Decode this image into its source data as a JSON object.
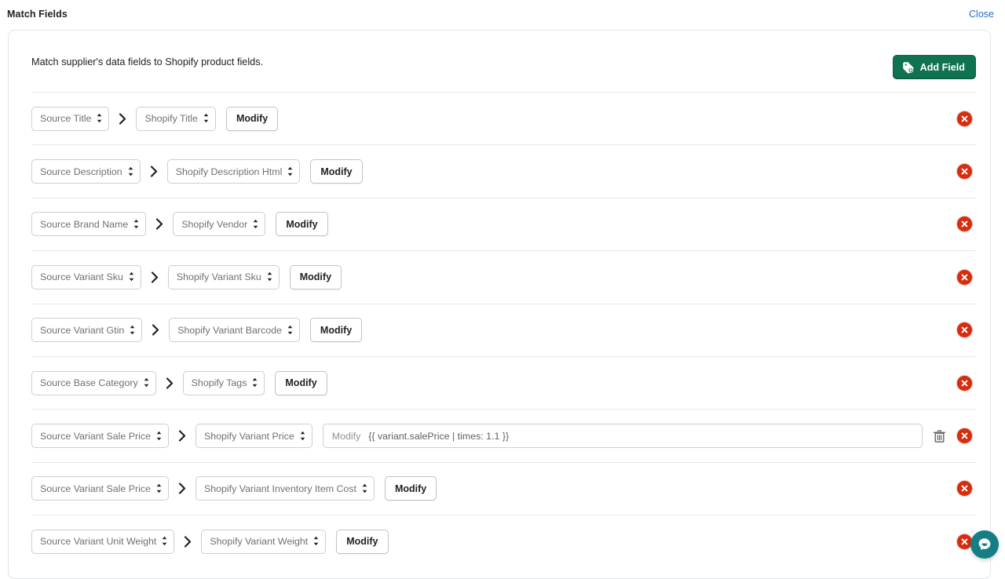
{
  "topbar": {
    "title": "Match Fields",
    "close_label": "Close"
  },
  "card": {
    "description": "Match supplier's data fields to Shopify product fields.",
    "add_field_label": "Add Field",
    "add_field_icon": "tag-plus-icon",
    "accent_green": "#0f7250",
    "accent_blue": "#2c6ecb",
    "accent_red": "#d82c0d",
    "chat_teal": "#157e84"
  },
  "rows": [
    {
      "source": "Source Title",
      "target": "Shopify Title",
      "modify_label": "Modify",
      "modify_expanded": false,
      "modify_value": "",
      "has_trash": false,
      "remove_label": "Remove field"
    },
    {
      "source": "Source Description",
      "target": "Shopify Description Html",
      "modify_label": "Modify",
      "modify_expanded": false,
      "modify_value": "",
      "has_trash": false,
      "remove_label": "Remove field"
    },
    {
      "source": "Source Brand Name",
      "target": "Shopify Vendor",
      "modify_label": "Modify",
      "modify_expanded": false,
      "modify_value": "",
      "has_trash": false,
      "remove_label": "Remove field"
    },
    {
      "source": "Source Variant Sku",
      "target": "Shopify Variant Sku",
      "modify_label": "Modify",
      "modify_expanded": false,
      "modify_value": "",
      "has_trash": false,
      "remove_label": "Remove field"
    },
    {
      "source": "Source Variant Gtin",
      "target": "Shopify Variant Barcode",
      "modify_label": "Modify",
      "modify_expanded": false,
      "modify_value": "",
      "has_trash": false,
      "remove_label": "Remove field"
    },
    {
      "source": "Source Base Category",
      "target": "Shopify Tags",
      "modify_label": "Modify",
      "modify_expanded": false,
      "modify_value": "",
      "has_trash": false,
      "remove_label": "Remove field"
    },
    {
      "source": "Source Variant Sale Price",
      "target": "Shopify Variant Price",
      "modify_label": "Modify",
      "modify_expanded": true,
      "modify_value": "{{ variant.salePrice | times: 1.1 }}",
      "has_trash": true,
      "remove_label": "Remove field"
    },
    {
      "source": "Source Variant Sale Price",
      "target": "Shopify Variant Inventory Item Cost",
      "modify_label": "Modify",
      "modify_expanded": false,
      "modify_value": "",
      "has_trash": false,
      "remove_label": "Remove field"
    },
    {
      "source": "Source Variant Unit Weight",
      "target": "Shopify Variant Weight",
      "modify_label": "Modify",
      "modify_expanded": false,
      "modify_value": "",
      "has_trash": false,
      "remove_label": "Remove field"
    }
  ],
  "chat": {
    "icon": "chat-bubble-icon",
    "label": "Open chat"
  }
}
